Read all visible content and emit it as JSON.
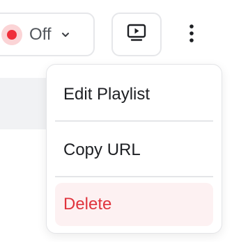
{
  "status": {
    "label": "Off",
    "dot_color": "#ef2f3a",
    "chevron_icon": "chevron-down-icon"
  },
  "toolbar": {
    "preview_icon": "monitor-play-icon",
    "more_icon": "more-vertical-icon"
  },
  "menu": {
    "items": [
      {
        "label": "Edit Playlist"
      },
      {
        "label": "Copy URL"
      },
      {
        "label": "Delete",
        "color": "#e0343d"
      }
    ]
  }
}
